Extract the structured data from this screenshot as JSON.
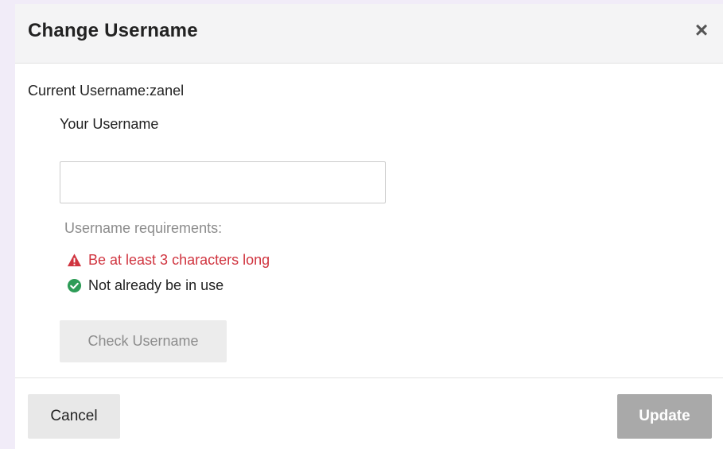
{
  "dialog": {
    "title": "Change Username",
    "close_glyph": "×"
  },
  "current_username": {
    "label": "Current Username:",
    "value": "zanel",
    "full_text": "Current Username:zanel"
  },
  "username_field": {
    "label": "Your Username",
    "value": "",
    "placeholder": ""
  },
  "requirements": {
    "title": "Username requirements:",
    "items": [
      {
        "text": "Be at least 3 characters long",
        "status": "fail",
        "icon": "warning-icon"
      },
      {
        "text": "Not already be in use",
        "status": "pass",
        "icon": "check-circle-icon"
      }
    ]
  },
  "buttons": {
    "check": "Check Username",
    "cancel": "Cancel",
    "update": "Update"
  },
  "colors": {
    "error": "#d0343f",
    "success": "#2e9c57",
    "disabled_button": "#a9a9a9",
    "muted_text": "#8c8c8c"
  }
}
